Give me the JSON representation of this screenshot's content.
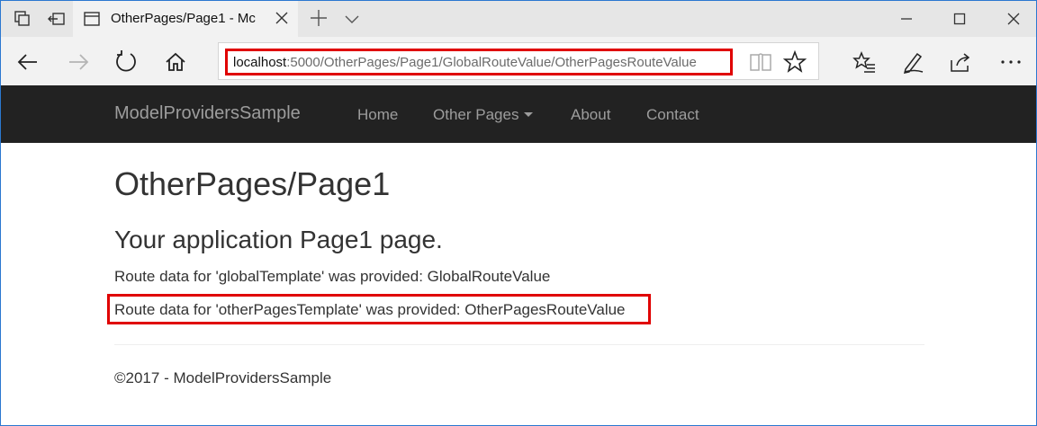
{
  "tab": {
    "title": "OtherPages/Page1 - Mc"
  },
  "address": {
    "host": "localhost",
    "rest": ":5000/OtherPages/Page1/GlobalRouteValue/OtherPagesRouteValue"
  },
  "site": {
    "brand": "ModelProvidersSample",
    "nav": {
      "home": "Home",
      "other_pages": "Other Pages",
      "about": "About",
      "contact": "Contact"
    }
  },
  "page": {
    "title": "OtherPages/Page1",
    "subtitle": "Your application Page1 page.",
    "route_global": "Route data for 'globalTemplate' was provided: GlobalRouteValue",
    "route_other": "Route data for 'otherPagesTemplate' was provided: OtherPagesRouteValue",
    "footer": "©2017 - ModelProvidersSample"
  },
  "colors": {
    "highlight": "#e00000",
    "navbar": "#222222",
    "window_border": "#2b78d0"
  }
}
